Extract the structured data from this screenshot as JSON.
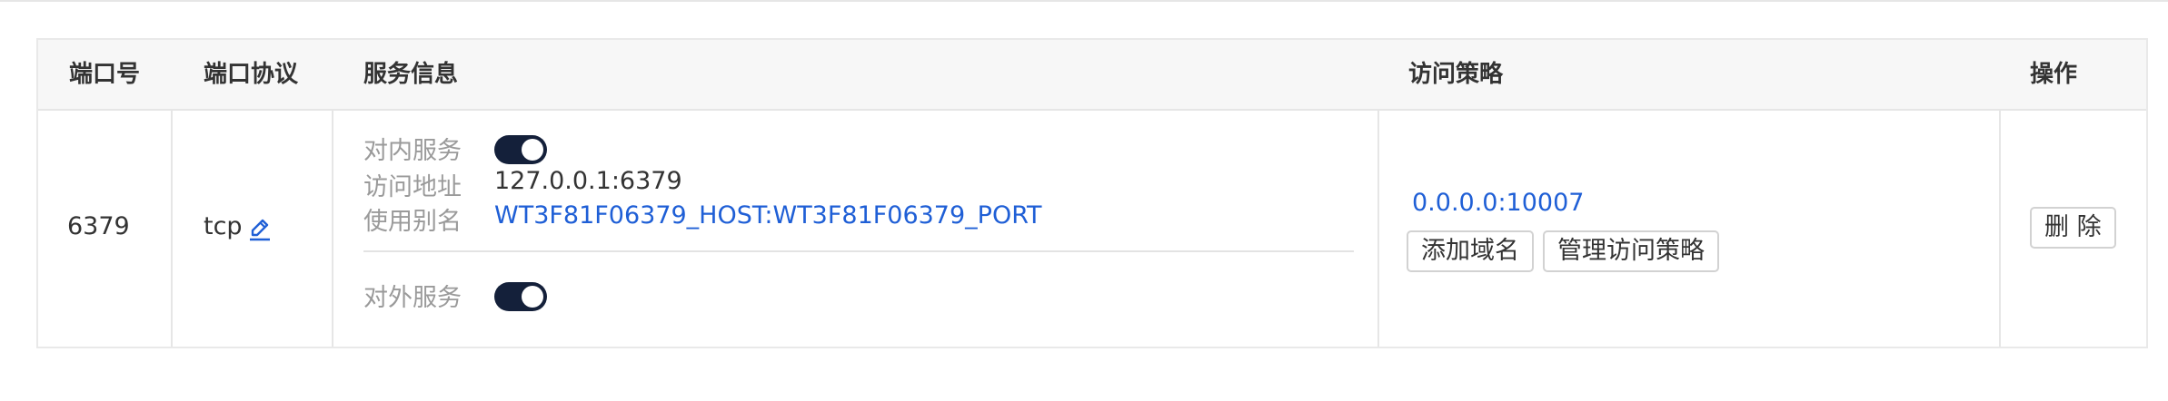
{
  "table": {
    "headers": {
      "port": "端口号",
      "protocol": "端口协议",
      "service_info": "服务信息",
      "access_policy": "访问策略",
      "actions": "操作"
    },
    "rows": [
      {
        "port": "6379",
        "protocol": "tcp",
        "service": {
          "inner_label": "对内服务",
          "inner_enabled": true,
          "address_label": "访问地址",
          "address_value": "127.0.0.1:6379",
          "alias_label": "使用别名",
          "alias_value": "WT3F81F06379_HOST:WT3F81F06379_PORT",
          "outer_label": "对外服务",
          "outer_enabled": true
        },
        "policy": {
          "address_link": "0.0.0.0:10007",
          "add_domain_label": "添加域名",
          "manage_policy_label": "管理访问策略"
        },
        "delete_label": "删 除"
      }
    ]
  },
  "colors": {
    "link": "#1f5fd6",
    "toggle_on": "#14203a",
    "header_bg": "#f7f7f7"
  },
  "icons": {
    "edit": "pencil-edit-icon"
  }
}
